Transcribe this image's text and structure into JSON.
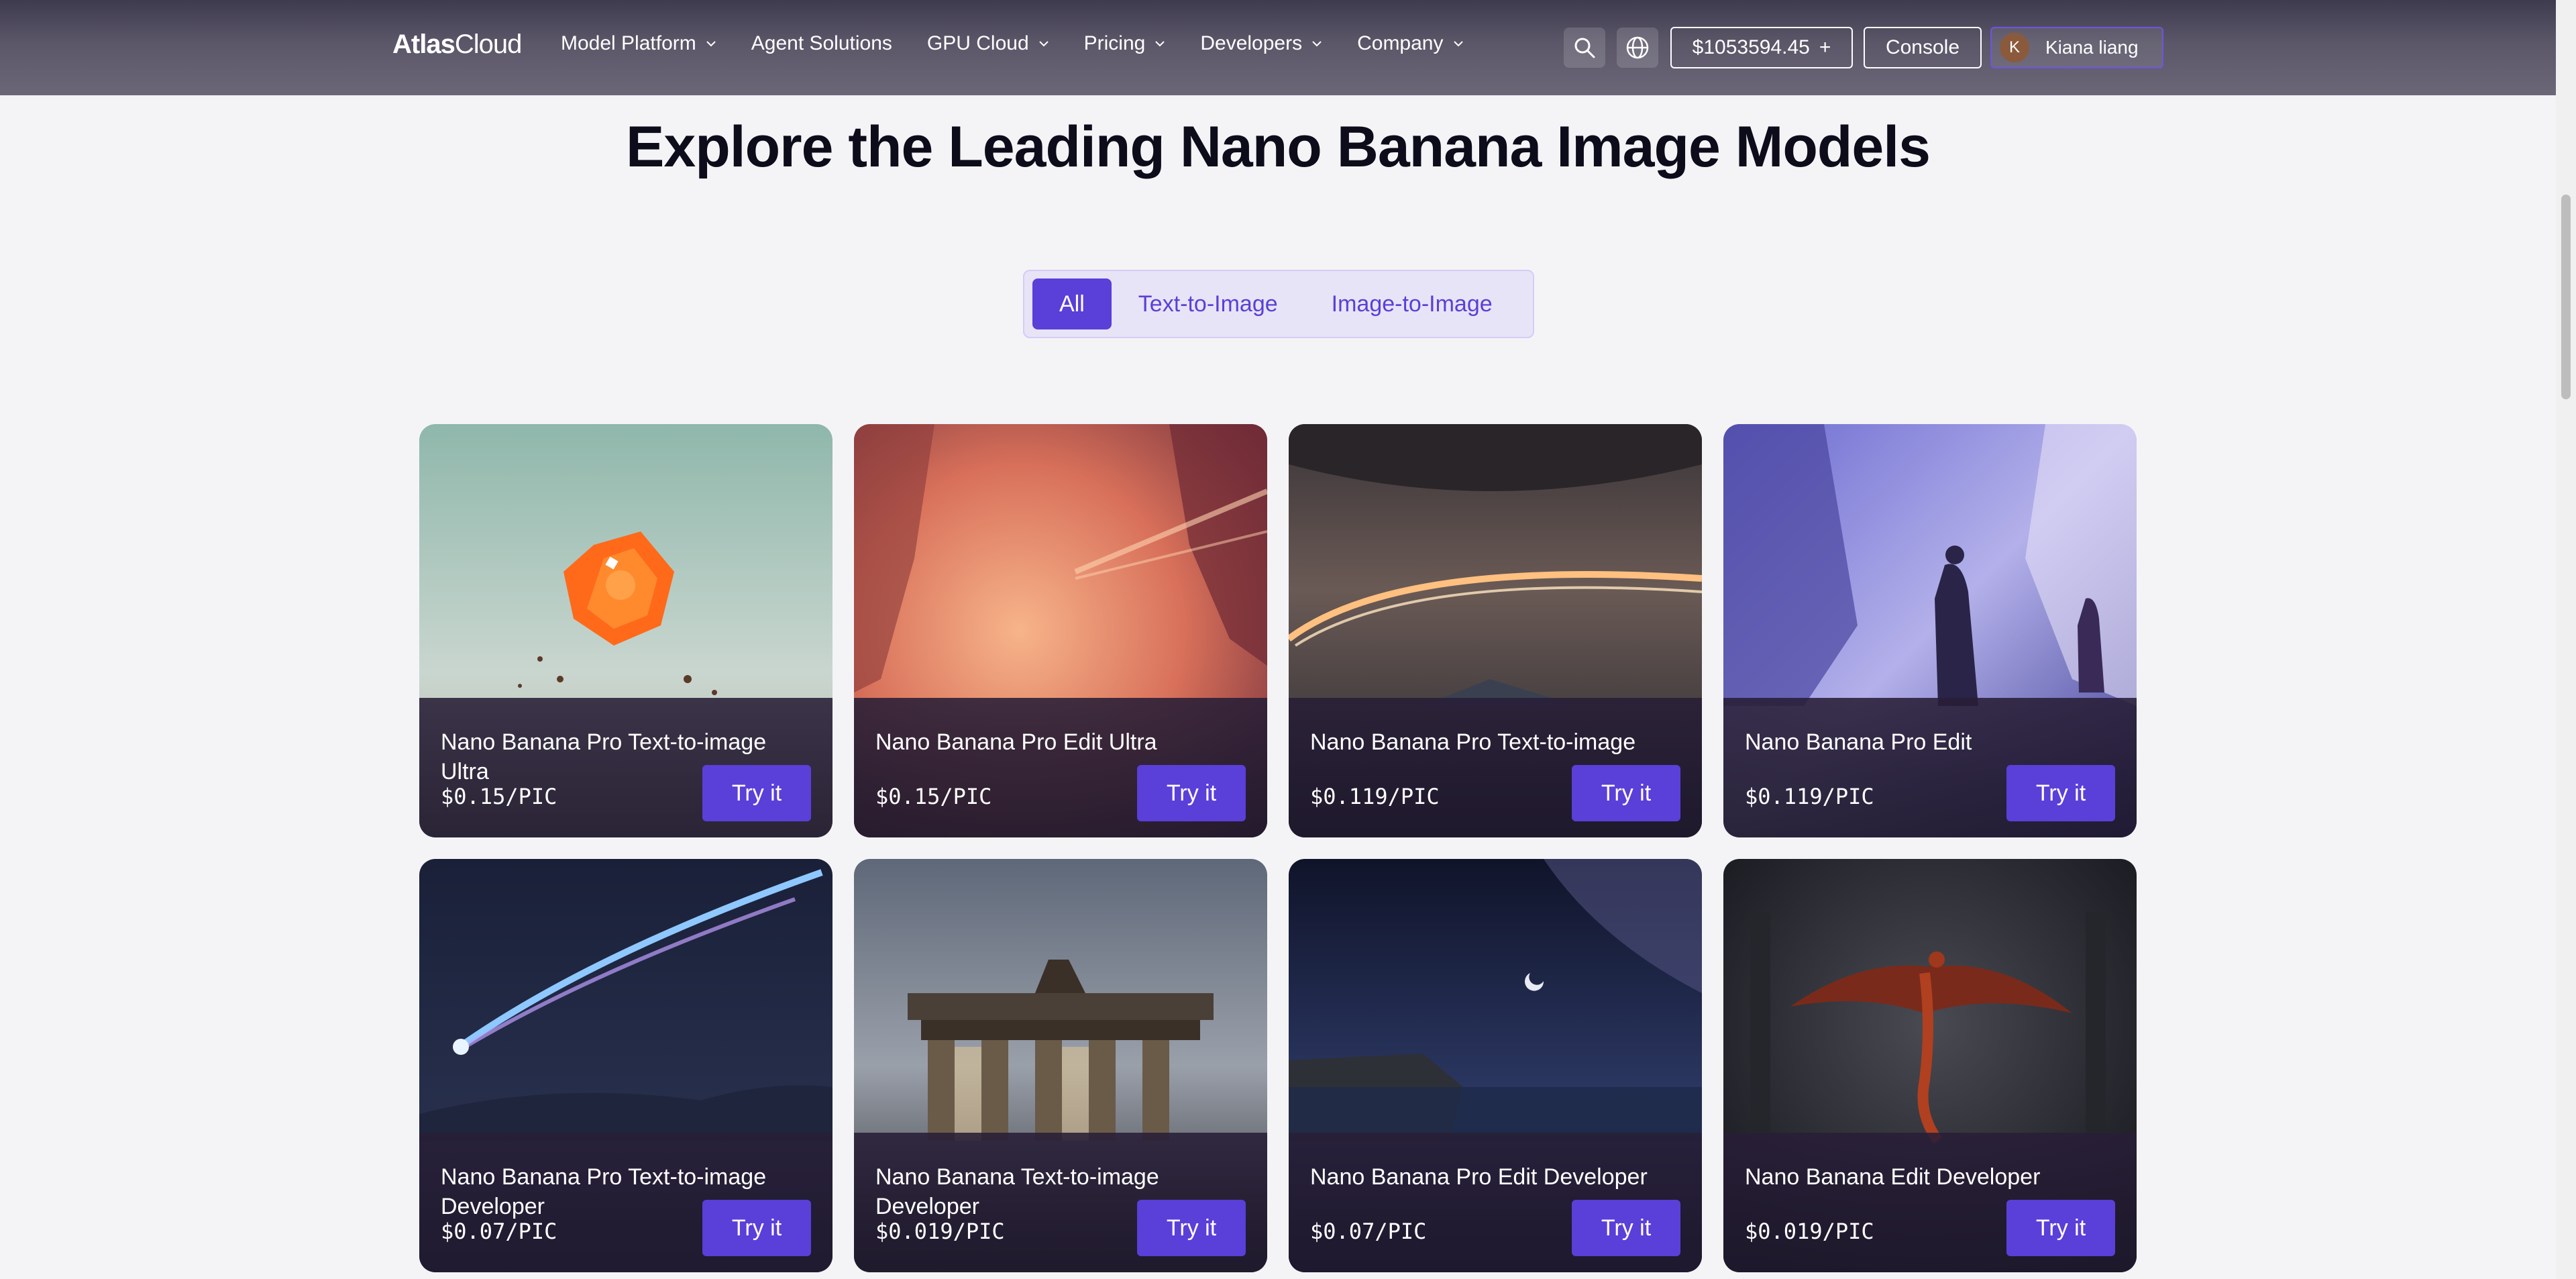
{
  "header": {
    "logo_main": "Atlas",
    "logo_sub": "Cloud",
    "nav": [
      {
        "label": "Model Platform",
        "dropdown": true
      },
      {
        "label": "Agent Solutions",
        "dropdown": false
      },
      {
        "label": "GPU Cloud",
        "dropdown": true
      },
      {
        "label": "Pricing",
        "dropdown": true
      },
      {
        "label": "Developers",
        "dropdown": true
      },
      {
        "label": "Company",
        "dropdown": true
      }
    ],
    "search_icon": "search-icon",
    "language_icon": "globe-icon",
    "balance": "$1053594.45",
    "balance_plus": "+",
    "console": "Console",
    "user_initial": "K",
    "user_name": "Kiana liang"
  },
  "main": {
    "title": "Explore the Leading Nano Banana Image Models",
    "tabs": [
      "All",
      "Text-to-Image",
      "Image-to-Image"
    ],
    "active_tab": "All",
    "cards": [
      {
        "name": "Nano Banana Pro Text-to-image Ultra",
        "price": "$0.15/PIC",
        "cta": "Try it"
      },
      {
        "name": "Nano Banana Pro Edit Ultra",
        "price": "$0.15/PIC",
        "cta": "Try it"
      },
      {
        "name": "Nano Banana Pro Text-to-image",
        "price": "$0.119/PIC",
        "cta": "Try it"
      },
      {
        "name": "Nano Banana Pro Edit",
        "price": "$0.119/PIC",
        "cta": "Try it"
      },
      {
        "name": "Nano Banana Pro Text-to-image Developer",
        "price": "$0.07/PIC",
        "cta": "Try it"
      },
      {
        "name": "Nano Banana Text-to-image Developer",
        "price": "$0.019/PIC",
        "cta": "Try it"
      },
      {
        "name": "Nano Banana Pro Edit Developer",
        "price": "$0.07/PIC",
        "cta": "Try it"
      },
      {
        "name": "Nano Banana Edit Developer",
        "price": "$0.019/PIC",
        "cta": "Try it"
      }
    ]
  },
  "colors": {
    "accent": "#5a3fd9",
    "header_bg": "#5b5769",
    "page_bg": "#f4f4f7"
  }
}
